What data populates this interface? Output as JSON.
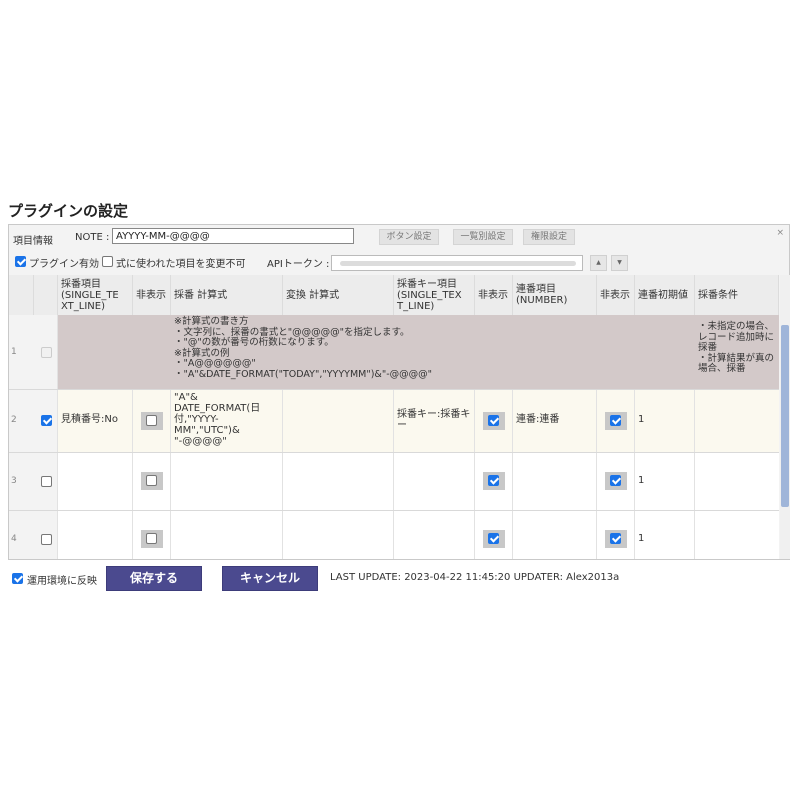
{
  "title": "プラグインの設定",
  "toolbar": {
    "item_info_label": "項目情報",
    "note_label": "NOTE :",
    "note_value": "AYYYY-MM-@@@@",
    "button_settings": "ボタン設定",
    "general_settings": "一覧別設定",
    "permission_settings": "権限設定",
    "close": "×"
  },
  "options": {
    "plugin_enabled_label": "プラグイン有効",
    "plugin_enabled": true,
    "change_disabled_label": "式に使われた項目を変更不可",
    "change_disabled": false,
    "api_token_label": "APIトークン :",
    "arrow_up": "▲",
    "arrow_down": "▼"
  },
  "table": {
    "headers": [
      "採番項目\n(SINGLE_TE\nXT_LINE)",
      "非表示",
      "採番 計算式",
      "変換 計算式",
      "採番キー項目\n(SINGLE_TEX\nT_LINE)",
      "非表示",
      "連番項目\n(NUMBER)",
      "非表示",
      "連番初期値",
      "採番条件"
    ],
    "rows": [
      {
        "num": "1",
        "checked": false,
        "field": "",
        "formula": "※計算式の書き方\n・文字列に、採番の書式と\"@@@@@\"を指定します。\n・\"@\"の数が番号の桁数になります。\n※計算式の例\n・\"A@@@@@@\"\n・\"A\"&DATE_FORMAT(\"TODAY\",\"YYYYMM\")&\"-@@@@\"",
        "condition": "・未指定の場合、\nレコード追加時に\n採番\n・計算結果が真の\n場合、採番"
      },
      {
        "num": "2",
        "checked": true,
        "field": "見積番号:No",
        "hide1": false,
        "formula": "\"A\"&\nDATE_FORMAT(日\n付,\"YYYY-\nMM\",\"UTC\")&\n\"-@@@@\"",
        "key_field": "採番キー:採番キ\nー",
        "hide2": true,
        "seq_field": "連番:連番",
        "hide3": true,
        "init": "1"
      },
      {
        "num": "3",
        "checked": false,
        "field": "",
        "hide1": false,
        "hide2": true,
        "hide3": true,
        "init": "1"
      },
      {
        "num": "4",
        "checked": false,
        "field": "",
        "hide1": false,
        "hide2": true,
        "hide3": true,
        "init": "1"
      }
    ]
  },
  "footer": {
    "apply_label": "運用環境に反映",
    "apply_checked": true,
    "save_label": "保存する",
    "cancel_label": "キャンセル",
    "status": "LAST UPDATE: 2023-04-22 11:45:20 UPDATER: Alex2013a"
  },
  "colors": {
    "accent": "#4b4a8f",
    "checkbox": "#1a73e8",
    "example_row": "#d3c9c9",
    "selected_row": "#fbf9ef"
  }
}
